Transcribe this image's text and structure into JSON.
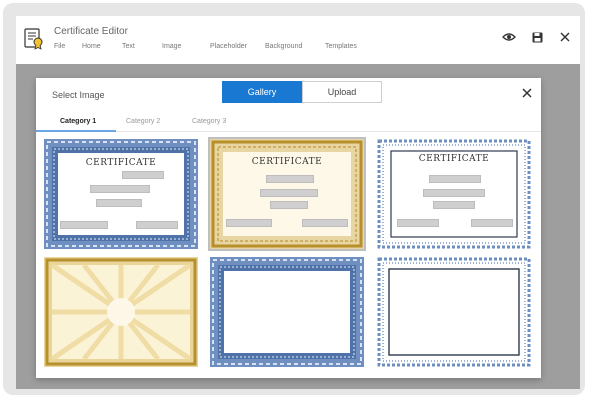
{
  "app": {
    "title": "Certificate Editor",
    "menu": [
      "File",
      "Home",
      "Text",
      "Image",
      "Placeholder",
      "Background",
      "Templates"
    ]
  },
  "window_actions": {
    "preview_icon": "eye-icon",
    "save_icon": "save-icon",
    "close_icon": "close-icon"
  },
  "modal": {
    "title": "Select Image",
    "segments": [
      {
        "label": "Gallery",
        "active": true
      },
      {
        "label": "Upload",
        "active": false
      }
    ],
    "tabs": [
      "Category 1",
      "Category 2",
      "Category 3"
    ],
    "active_tab": "Category 1"
  },
  "gallery": {
    "items": [
      {
        "style": "blue-scallop",
        "title": "CERTIFICATE",
        "has_fields": true
      },
      {
        "style": "gold",
        "title": "CERTIFICATE",
        "has_fields": true
      },
      {
        "style": "blue-floral",
        "title": "CERTIFICATE",
        "has_fields": true
      },
      {
        "style": "gold-sunburst",
        "title": "",
        "has_fields": false
      },
      {
        "style": "blue-scallop",
        "title": "",
        "has_fields": false
      },
      {
        "style": "blue-floral",
        "title": "",
        "has_fields": false
      }
    ]
  },
  "colors": {
    "accent": "#1978d1",
    "blue_border": "#5a7fb3",
    "gold_border": "#d1b15a",
    "backdrop": "#9e9e9e"
  }
}
